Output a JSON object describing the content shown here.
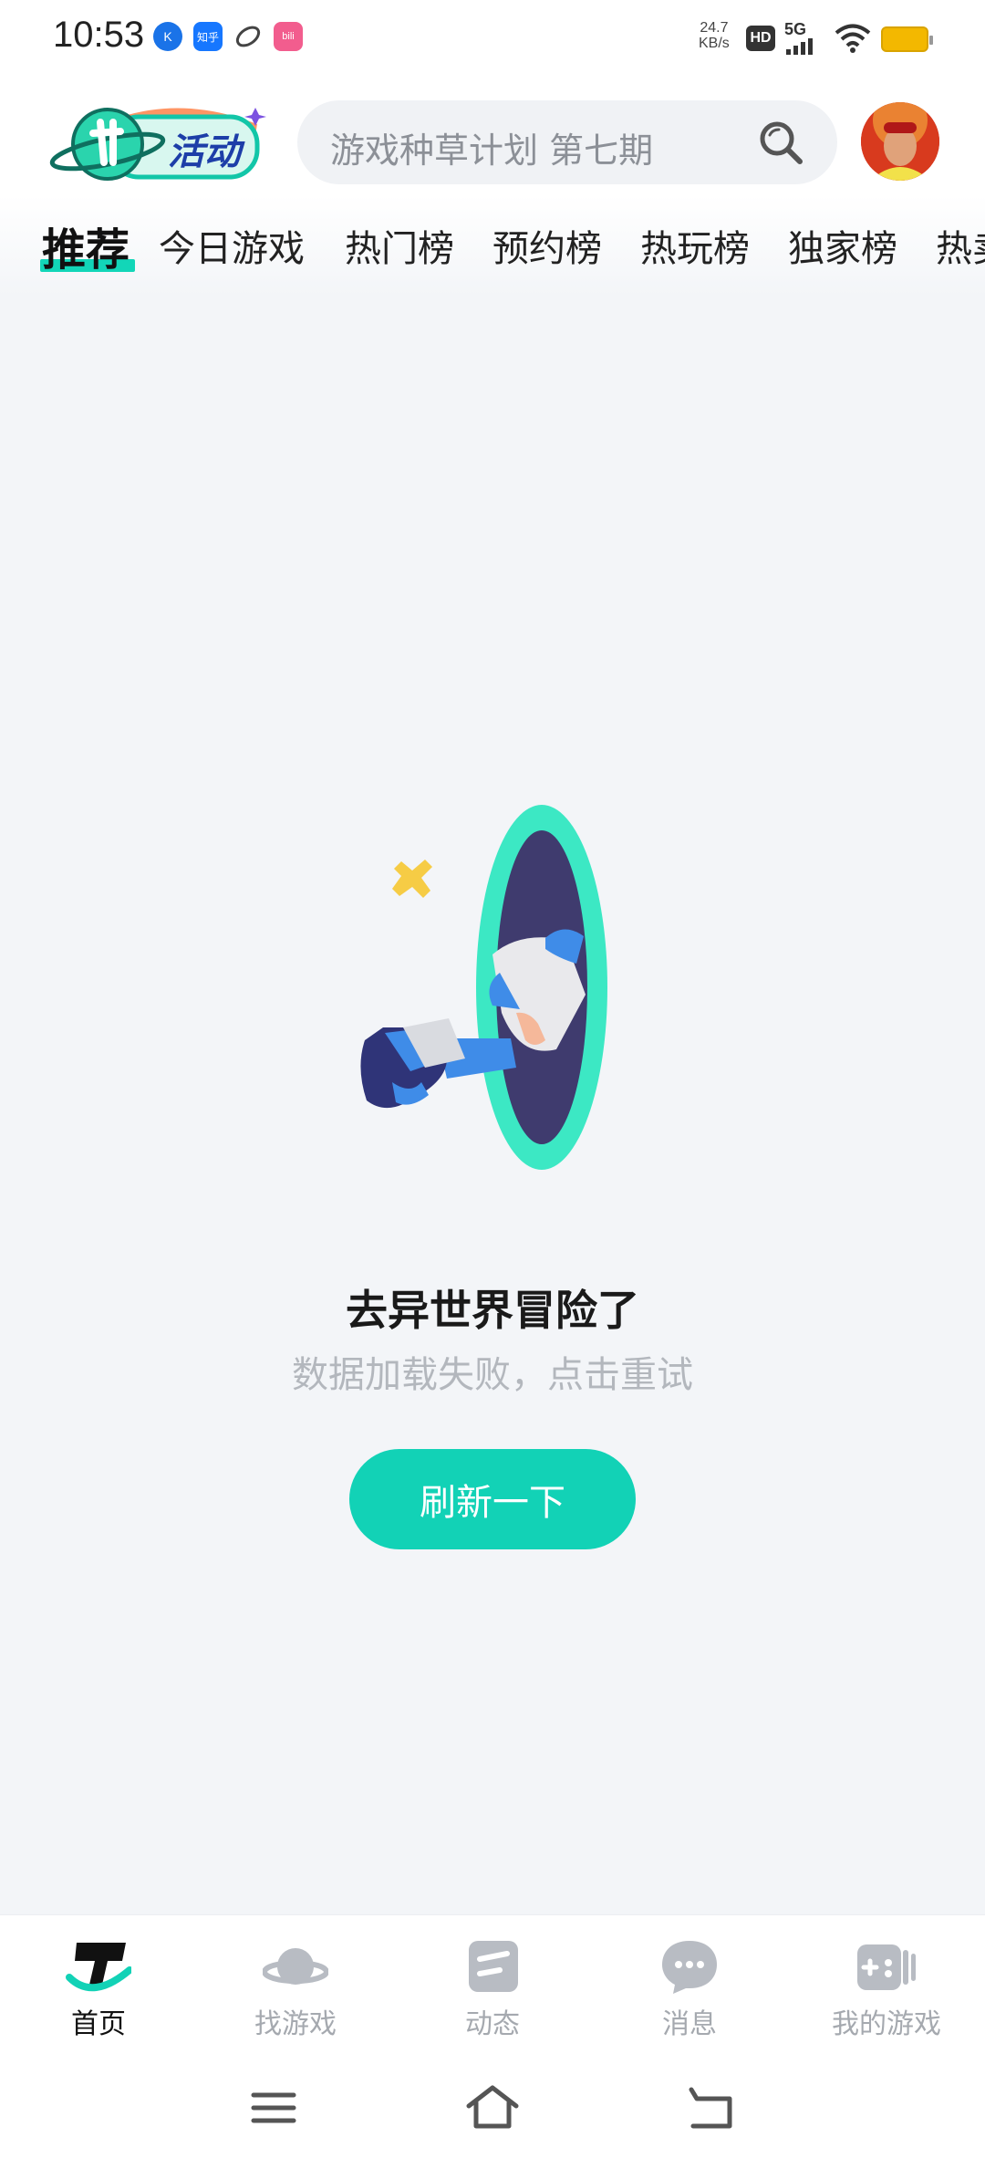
{
  "status_bar": {
    "time": "10:53",
    "apps": [
      "K",
      "知乎",
      "",
      "bili"
    ],
    "net_speed_value": "24.7",
    "net_speed_unit": "KB/s",
    "hd": "HD",
    "network": "5G",
    "battery_color": "#f3b800"
  },
  "header": {
    "activity_label": "活动",
    "search_placeholder": "游戏种草计划 第七期",
    "search_icon": "search-icon",
    "avatar": "user-avatar"
  },
  "tabs": [
    {
      "label": "推荐",
      "active": true
    },
    {
      "label": "今日游戏",
      "active": false
    },
    {
      "label": "热门榜",
      "active": false
    },
    {
      "label": "预约榜",
      "active": false
    },
    {
      "label": "热玩榜",
      "active": false
    },
    {
      "label": "独家榜",
      "active": false
    },
    {
      "label": "热卖",
      "active": false
    }
  ],
  "empty_state": {
    "title": "去异世界冒险了",
    "subtitle": "数据加载失败，点击重试",
    "refresh_label": "刷新一下",
    "accent_color": "#12d2b6"
  },
  "bottom_nav": [
    {
      "label": "首页",
      "icon": "home-taptap-icon",
      "active": true
    },
    {
      "label": "找游戏",
      "icon": "planet-icon",
      "active": false
    },
    {
      "label": "动态",
      "icon": "feed-icon",
      "active": false
    },
    {
      "label": "消息",
      "icon": "chat-bubble-icon",
      "active": false
    },
    {
      "label": "我的游戏",
      "icon": "gamepad-icon",
      "active": false
    }
  ],
  "system_nav": [
    "menu-icon",
    "home-icon",
    "back-icon"
  ]
}
